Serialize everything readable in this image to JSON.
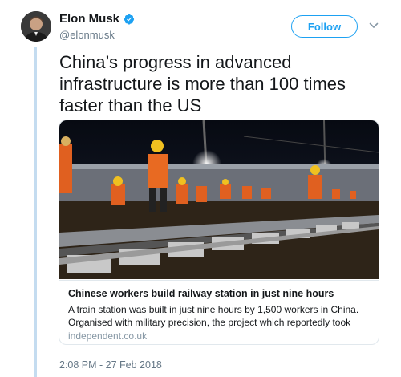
{
  "author": {
    "name": "Elon Musk",
    "handle": "@elonmusk",
    "verified": true,
    "avatar_icon": "profile-photo"
  },
  "actions": {
    "follow_label": "Follow",
    "menu_icon": "chevron-down-icon"
  },
  "tweet": {
    "text": "China’s progress in advanced infrastructure is more than 100 times faster than the US",
    "timestamp": "2:08 PM - 27 Feb 2018"
  },
  "card": {
    "title": "Chinese workers build railway station in just nine hours",
    "description": "A train station was built in just nine hours by 1,500 workers in China. Organised with military precision, the project which reportedly took",
    "domain": "independent.co.uk",
    "image_icon": "railway-construction-photo"
  },
  "colors": {
    "accent": "#1da1f2",
    "thread_line": "#c4dcf0",
    "muted": "#657786"
  }
}
